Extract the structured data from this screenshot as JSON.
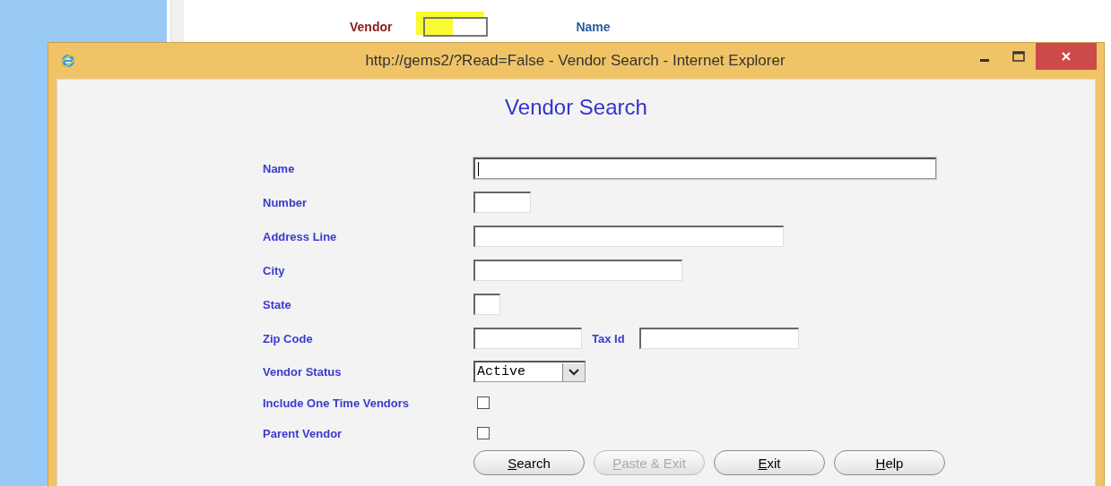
{
  "background_page": {
    "vendor_label": "Vendor",
    "vendor_field_highlighted": true,
    "name_label": "Name"
  },
  "window": {
    "title": "http://gems2/?Read=False - Vendor Search - Internet Explorer"
  },
  "heading": "Vendor Search",
  "fields": [
    {
      "kind": "text",
      "label": "Name",
      "focused": true
    },
    {
      "kind": "text",
      "label": "Number",
      "focused": false
    },
    {
      "kind": "text",
      "label": "Address Line",
      "focused": false
    },
    {
      "kind": "text",
      "label": "City",
      "focused": false
    },
    {
      "kind": "text",
      "label": "State",
      "focused": false
    },
    {
      "kind": "pair",
      "label": "Zip Code",
      "second_label": "Tax Id"
    },
    {
      "kind": "select",
      "label": "Vendor Status",
      "value": "Active"
    },
    {
      "kind": "checkbox",
      "label": "Include One Time Vendors",
      "checked": false
    },
    {
      "kind": "checkbox",
      "label": "Parent Vendor",
      "checked": false
    }
  ],
  "buttons": [
    {
      "label": "Search",
      "disabled": false
    },
    {
      "label": "Paste & Exit",
      "disabled": true
    },
    {
      "label": "Exit",
      "disabled": false
    },
    {
      "label": "Help",
      "disabled": false
    }
  ]
}
